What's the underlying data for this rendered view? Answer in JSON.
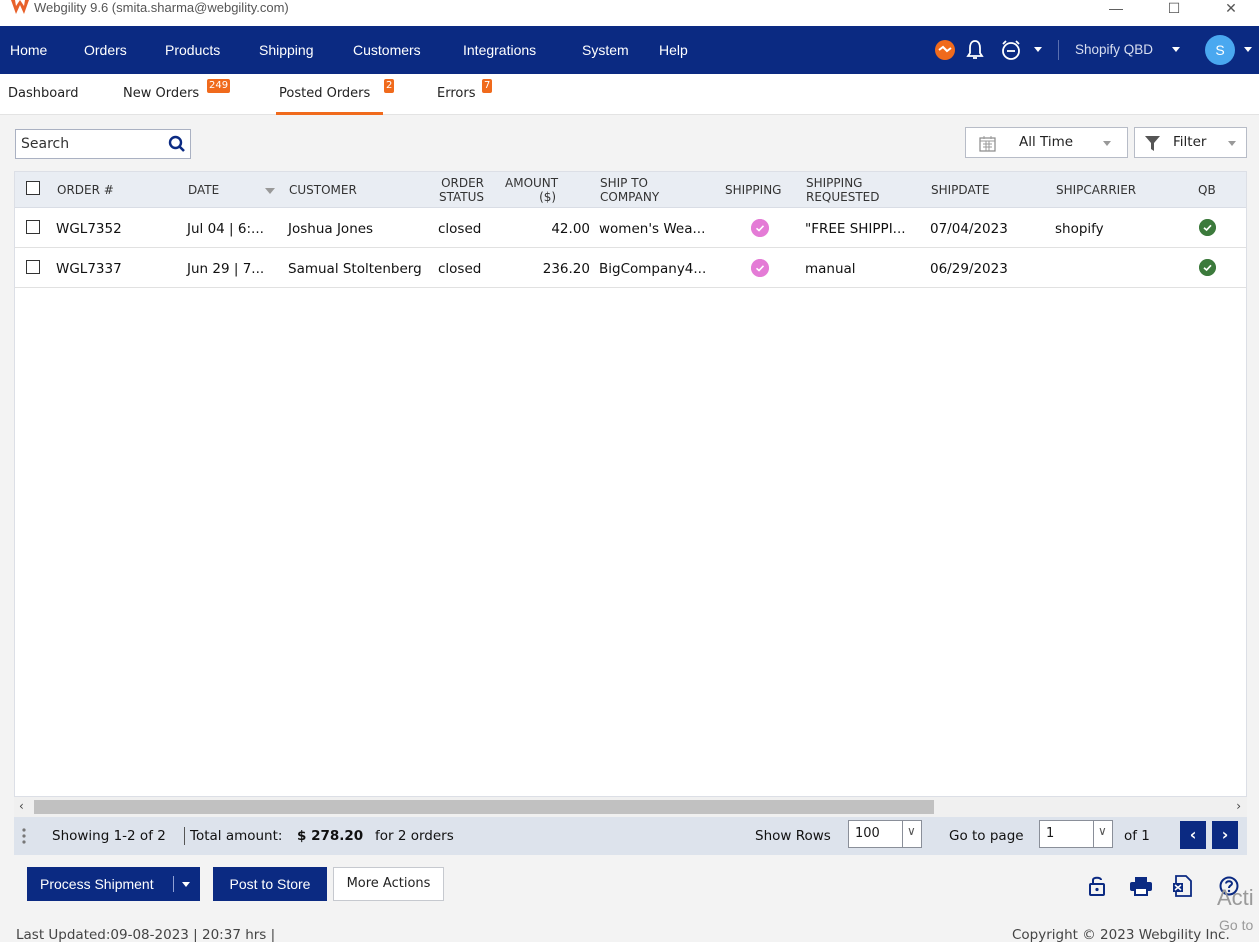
{
  "window": {
    "title": "Webgility 9.6 (smita.sharma@webgility.com)"
  },
  "navbar": {
    "items": [
      "Home",
      "Orders",
      "Products",
      "Shipping",
      "Customers",
      "Integrations",
      "System",
      "Help"
    ],
    "store_selector": "Shopify QBD",
    "avatar_initial": "S"
  },
  "tabs": [
    {
      "label": "Dashboard",
      "badge": ""
    },
    {
      "label": "New Orders",
      "badge": "249"
    },
    {
      "label": "Posted Orders",
      "badge": "2"
    },
    {
      "label": "Errors",
      "badge": "7"
    }
  ],
  "toolbar": {
    "search_placeholder": "Search",
    "date_range": "All Time",
    "filter_label": "Filter"
  },
  "table": {
    "headers": {
      "order": "ORDER #",
      "date": "DATE",
      "customer": "CUSTOMER",
      "order_status_1": "ORDER",
      "order_status_2": "STATUS",
      "amount_1": "AMOUNT",
      "amount_2": "($)",
      "ship_to_1": "SHIP TO",
      "ship_to_2": "COMPANY",
      "shipping": "SHIPPING",
      "shipping_req_1": "SHIPPING",
      "shipping_req_2": "REQUESTED",
      "shipdate": "SHIPDATE",
      "shipcarrier": "SHIPCARRIER",
      "qb": "QB"
    },
    "rows": [
      {
        "order": "WGL7352",
        "date": "Jul 04 | 6:...",
        "customer": "Joshua Jones",
        "status": "closed",
        "amount": "42.00",
        "ship_to": "women's Wea...",
        "shipping_requested": "\"FREE SHIPPI...",
        "shipdate": "07/04/2023",
        "shipcarrier": "shopify"
      },
      {
        "order": "WGL7337",
        "date": "Jun 29 | 7...",
        "customer": "Samual Stoltenberg",
        "status": "closed",
        "amount": "236.20",
        "ship_to": "BigCompany4...",
        "shipping_requested": "manual",
        "shipdate": "06/29/2023",
        "shipcarrier": ""
      }
    ]
  },
  "footer": {
    "showing": "Showing 1-2 of 2",
    "total_label": "Total amount:",
    "total_value": "$ 278.20",
    "total_suffix": "for 2 orders",
    "show_rows_label": "Show Rows",
    "show_rows_value": "100",
    "go_to_page_label": "Go to page",
    "page_value": "1",
    "page_of": "of 1"
  },
  "actions": {
    "process_shipment": "Process Shipment",
    "post_to_store": "Post to Store",
    "more_actions": "More Actions"
  },
  "status_bar": {
    "last_updated": "Last Updated:09-08-2023 | 20:37 hrs |",
    "copyright": "Copyright © 2023 Webgility Inc."
  },
  "watermark": {
    "line1": "Acti",
    "line2": "Go to"
  },
  "colors": {
    "nav_bg": "#0b2a82",
    "accent": "#f06a1c",
    "shipping_badge": "#e47bd6",
    "qb_status": "#3c7a3c"
  }
}
